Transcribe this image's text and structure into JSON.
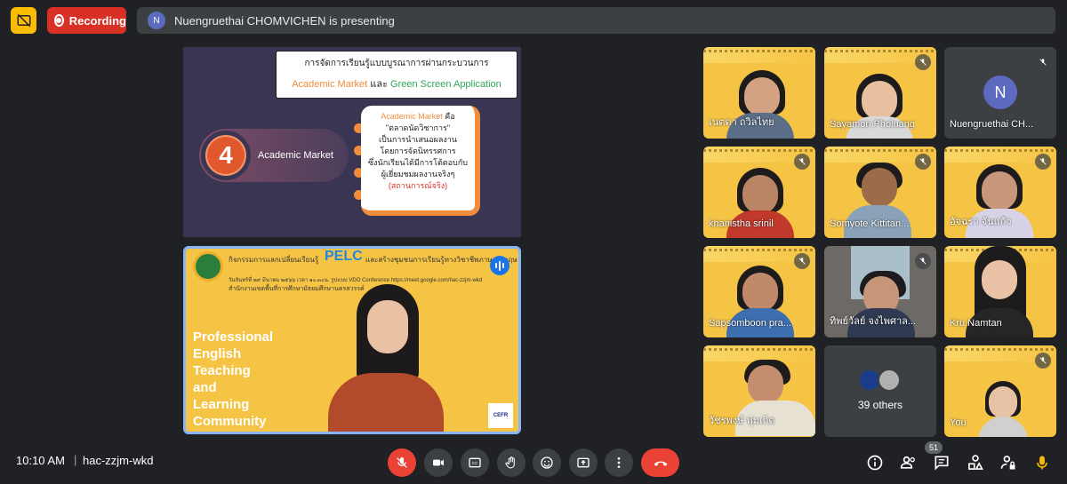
{
  "topbar": {
    "recording_label": "Recording",
    "presenter_initial": "N",
    "presenting_text": "Nuengruethai CHOMVICHEN is presenting"
  },
  "slide": {
    "title_line1": "การจัดการเรียนรู้แบบบูรณาการผ่านกระบวนการ",
    "title_part_a": "Academic Market",
    "title_and": " และ ",
    "title_part_b": "Green Screen Application",
    "number": "4",
    "pill_label": "Academic Market",
    "card_head": "Academic Market",
    "card_is": " คือ",
    "card_line2": "\"ตลาดนัดวิชาการ\"",
    "card_line3": "เป็นการนำเสนอผลงาน",
    "card_line4": "โดยการจัดนิทรรศการ",
    "card_line5": "ซึ่งนักเรียนได้มีการโต้ตอบกับ",
    "card_line6": "ผู้เยี่ยมชมผลงานจริงๆ",
    "card_line7": "(สถานการณ์จริง)"
  },
  "speaker": {
    "header1": "กิจกรรมการแลกเปลี่ยนเรียนรู้",
    "pelc": "PELC",
    "header1b": "และสร้างชุมชนการเรียนรู้ทางวิชาชีพภาษาอังกฤษ",
    "header2": "วันจันทร์ที่ ๒๙ มีนาคม ๒๕๖๖ เวลา ๑๐.๓๐น. รูปแบบ VDO Conference https://meet.google.com/hac-zzjm-wkd",
    "header3": "สำนักงานเขตพื้นที่การศึกษามัธยมศึกษานครสวรรค์",
    "big_text": [
      "Professional",
      "English",
      "Teaching",
      "and",
      "Learning",
      "Community"
    ],
    "cefr": "CEFR"
  },
  "participants": [
    {
      "name": "เนตดา ถวิลไทย",
      "muted": false
    },
    {
      "name": "Sayamon Pholuang",
      "muted": true
    },
    {
      "name": "Nuengruethai CH...",
      "muted": true,
      "initial": "N"
    },
    {
      "name": "khanistha srinil",
      "muted": true
    },
    {
      "name": "Somyote Kittitan...",
      "muted": true
    },
    {
      "name": "อัจฉรา จันแก้ว",
      "muted": true
    },
    {
      "name": "Sapsomboon pra...",
      "muted": true
    },
    {
      "name": "ทิพย์วัลย์ จงไพศาล...",
      "muted": true
    },
    {
      "name": "Kru Namtan",
      "muted": false
    },
    {
      "name": "วัชรพงษ์ พุ่มเกิด",
      "muted": false
    },
    {
      "name": "39 others",
      "muted": false
    },
    {
      "name": "You",
      "muted": true
    }
  ],
  "bottombar": {
    "time": "10:10 AM",
    "separator": "|",
    "meeting_code": "hac-zzjm-wkd",
    "people_count": "51"
  },
  "colors": {
    "background": "#202124",
    "tile_dark": "#3c4043",
    "accent_red": "#ea4335",
    "accent_yellow": "#fbbc04",
    "accent_blue": "#8ab4f8",
    "avatar": "#5c6bc0"
  }
}
